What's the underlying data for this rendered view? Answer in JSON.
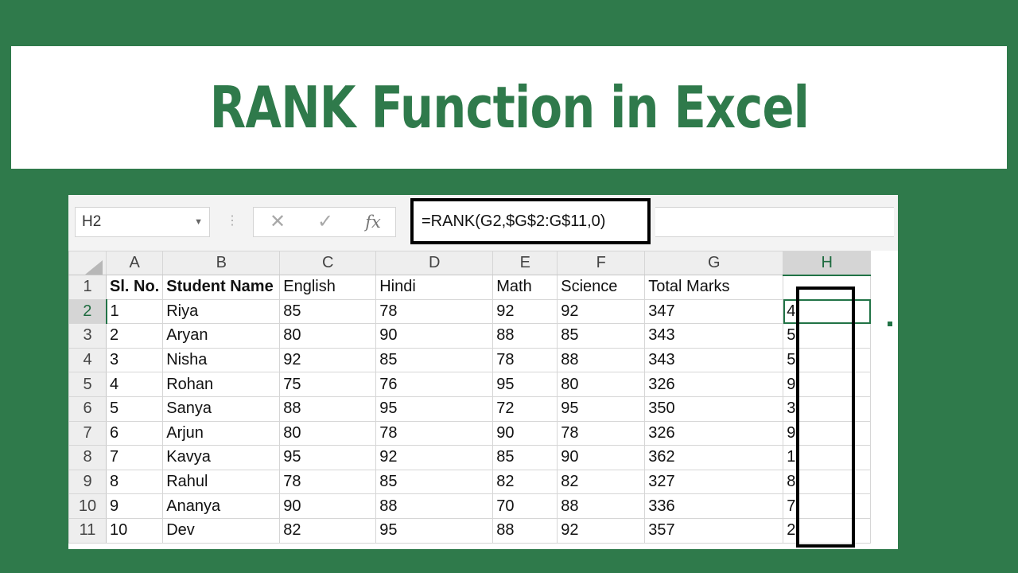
{
  "banner": {
    "title": "RANK Function in Excel"
  },
  "formula_bar": {
    "name_box": "H2",
    "cancel_symbol": "✕",
    "enter_symbol": "✓",
    "fx_label": "fx",
    "formula": "=RANK(G2,$G$2:G$11,0)"
  },
  "grid": {
    "columns": [
      "A",
      "B",
      "C",
      "D",
      "E",
      "F",
      "G",
      "H"
    ],
    "rows": [
      {
        "num": "1",
        "cells": [
          "Sl. No.",
          "Student Name",
          "English",
          "Hindi",
          "Math",
          "Science",
          "Total Marks",
          ""
        ]
      },
      {
        "num": "2",
        "cells": [
          "1",
          "Riya",
          "85",
          "78",
          "92",
          "92",
          "347",
          "4"
        ]
      },
      {
        "num": "3",
        "cells": [
          "2",
          "Aryan",
          "80",
          "90",
          "88",
          "85",
          "343",
          "5"
        ]
      },
      {
        "num": "4",
        "cells": [
          "3",
          "Nisha",
          "92",
          "85",
          "78",
          "88",
          "343",
          "5"
        ]
      },
      {
        "num": "5",
        "cells": [
          "4",
          "Rohan",
          "75",
          "76",
          "95",
          "80",
          "326",
          "9"
        ]
      },
      {
        "num": "6",
        "cells": [
          "5",
          "Sanya",
          "88",
          "95",
          "72",
          "95",
          "350",
          "3"
        ]
      },
      {
        "num": "7",
        "cells": [
          "6",
          "Arjun",
          "80",
          "78",
          "90",
          "78",
          "326",
          "9"
        ]
      },
      {
        "num": "8",
        "cells": [
          "7",
          "Kavya",
          "95",
          "92",
          "85",
          "90",
          "362",
          "1"
        ]
      },
      {
        "num": "9",
        "cells": [
          "8",
          "Rahul",
          "78",
          "85",
          "82",
          "82",
          "327",
          "8"
        ]
      },
      {
        "num": "10",
        "cells": [
          "9",
          "Ananya",
          "90",
          "88",
          "70",
          "88",
          "336",
          "7"
        ]
      },
      {
        "num": "11",
        "cells": [
          "10",
          "Dev",
          "82",
          "95",
          "88",
          "92",
          "357",
          "2"
        ]
      }
    ]
  },
  "colors": {
    "background": "#2f7a4b",
    "title": "#2f7a4b",
    "excel_green": "#217346",
    "highlight_border": "#000000"
  }
}
